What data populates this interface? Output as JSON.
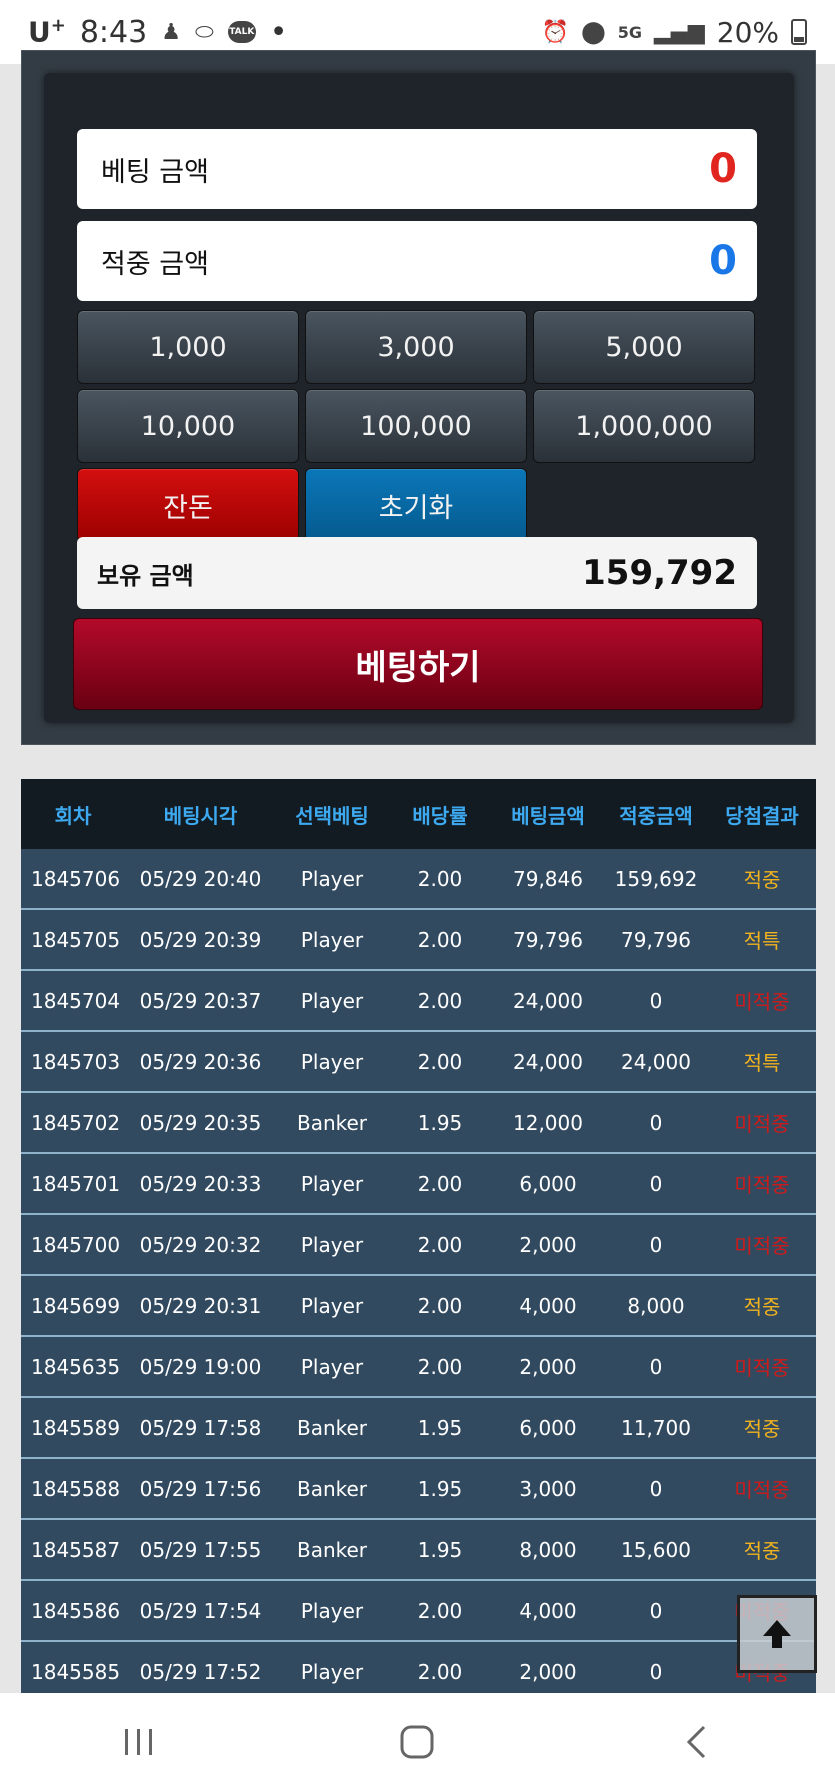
{
  "status_bar": {
    "carrier": "U",
    "carrier_sup": "+",
    "time": "8:43",
    "dot": "•",
    "network": "5G",
    "battery_percent": "20%"
  },
  "bet_panel": {
    "bet_amount_label": "베팅 금액",
    "bet_amount_value": "0",
    "win_amount_label": "적중 금액",
    "win_amount_value": "0",
    "chips": [
      "1,000",
      "3,000",
      "5,000",
      "10,000",
      "100,000",
      "1,000,000"
    ],
    "change_label": "잔돈",
    "reset_label": "초기화",
    "hold_label": "보유 금액",
    "hold_value": "159,792",
    "bet_button_label": "베팅하기",
    "colors": {
      "bet_value": "#e0261f",
      "win_value": "#1a77e8",
      "bet_button": "#9a0620"
    }
  },
  "history": {
    "columns": [
      "회차",
      "베팅시각",
      "선택베팅",
      "배당률",
      "베팅금액",
      "적중금액",
      "당첨결과"
    ],
    "rows": [
      [
        "1845706",
        "05/29 20:40",
        "Player",
        "2.00",
        "79,846",
        "159,692",
        "적중"
      ],
      [
        "1845705",
        "05/29 20:39",
        "Player",
        "2.00",
        "79,796",
        "79,796",
        "적특"
      ],
      [
        "1845704",
        "05/29 20:37",
        "Player",
        "2.00",
        "24,000",
        "0",
        "미적중"
      ],
      [
        "1845703",
        "05/29 20:36",
        "Player",
        "2.00",
        "24,000",
        "24,000",
        "적특"
      ],
      [
        "1845702",
        "05/29 20:35",
        "Banker",
        "1.95",
        "12,000",
        "0",
        "미적중"
      ],
      [
        "1845701",
        "05/29 20:33",
        "Player",
        "2.00",
        "6,000",
        "0",
        "미적중"
      ],
      [
        "1845700",
        "05/29 20:32",
        "Player",
        "2.00",
        "2,000",
        "0",
        "미적중"
      ],
      [
        "1845699",
        "05/29 20:31",
        "Player",
        "2.00",
        "4,000",
        "8,000",
        "적중"
      ],
      [
        "1845635",
        "05/29 19:00",
        "Player",
        "2.00",
        "2,000",
        "0",
        "미적중"
      ],
      [
        "1845589",
        "05/29 17:58",
        "Banker",
        "1.95",
        "6,000",
        "11,700",
        "적중"
      ],
      [
        "1845588",
        "05/29 17:56",
        "Banker",
        "1.95",
        "3,000",
        "0",
        "미적중"
      ],
      [
        "1845587",
        "05/29 17:55",
        "Banker",
        "1.95",
        "8,000",
        "15,600",
        "적중"
      ],
      [
        "1845586",
        "05/29 17:54",
        "Player",
        "2.00",
        "4,000",
        "0",
        "미적중"
      ],
      [
        "1845585",
        "05/29 17:52",
        "Player",
        "2.00",
        "2,000",
        "0",
        "미적중"
      ]
    ],
    "result_colors": {
      "적중": "#f0b21e",
      "적특": "#f0b21e",
      "미적중": "#d01a1a"
    }
  },
  "icons": {
    "scroll_top": "arrow-up-icon",
    "nav": [
      "recent-apps-icon",
      "home-icon",
      "back-icon"
    ]
  }
}
